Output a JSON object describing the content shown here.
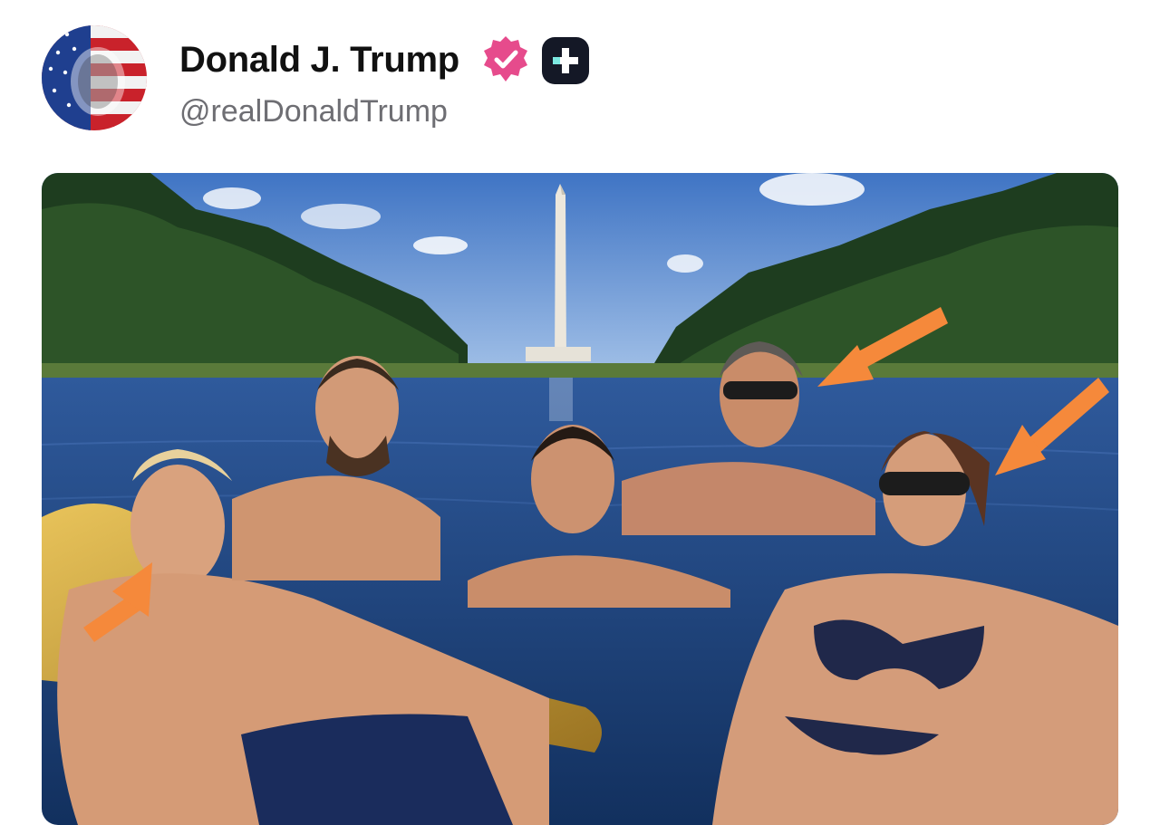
{
  "post": {
    "author": {
      "display_name": "Donald J. Trump",
      "handle": "@realDonaldTrump",
      "avatar_icon": "flag-portrait-avatar",
      "badges": [
        "verified-badge-icon",
        "plus-badge-icon"
      ]
    },
    "media": {
      "type": "image",
      "scene": "five-people-in-reflecting-pool-photo",
      "annotation_arrows": 3,
      "arrow_color": "#F5893B"
    }
  },
  "colors": {
    "verified": "#E64B8C",
    "plus_badge_bg": "#141826",
    "plus_badge_fg": "#7CE8E0",
    "name_text": "#111111",
    "handle_text": "#6E6E73"
  }
}
